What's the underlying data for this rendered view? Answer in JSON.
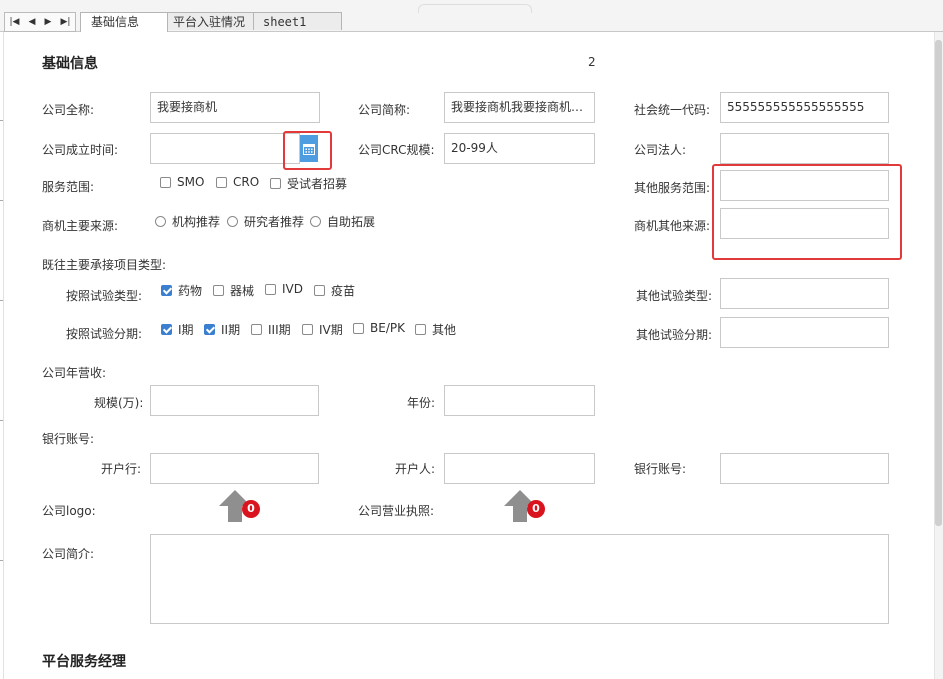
{
  "tabs": {
    "nav_first": "|◀",
    "nav_prev": "◀",
    "nav_next": "▶",
    "nav_last": "▶|",
    "items": [
      "基础信息",
      "平台入驻情况",
      "sheet1"
    ]
  },
  "basic": {
    "title": "基础信息",
    "page_number": "2",
    "company_name_label": "公司全称:",
    "company_name_value": "我要接商机",
    "short_name_label": "公司简称:",
    "short_name_value": "我要接商机我要接商机我要接商机",
    "credit_code_label": "社会统一代码:",
    "credit_code_value": "555555555555555555",
    "founded_label": "公司成立时间:",
    "founded_value": "",
    "crc_label": "公司CRC规模:",
    "crc_value": "20-99人",
    "legal_label": "公司法人:",
    "legal_value": "",
    "scope_label": "服务范围:",
    "scope_options": [
      {
        "label": "SMO",
        "checked": false
      },
      {
        "label": "CRO",
        "checked": false
      },
      {
        "label": "受试者招募",
        "checked": false
      }
    ],
    "other_scope_label": "其他服务范围:",
    "other_scope_value": "",
    "source_label": "商机主要来源:",
    "source_options": [
      "机构推荐",
      "研究者推荐",
      "自助拓展"
    ],
    "other_source_label": "商机其他来源:",
    "other_source_value": "",
    "project_type_label": "既往主要承接项目类型:",
    "trial_type_label": "按照试验类型:",
    "trial_type_options": [
      {
        "label": "药物",
        "checked": true
      },
      {
        "label": "器械",
        "checked": false
      },
      {
        "label": "IVD",
        "checked": false
      },
      {
        "label": "疫苗",
        "checked": false
      }
    ],
    "other_trial_type_label": "其他试验类型:",
    "other_trial_type_value": "",
    "trial_phase_label": "按照试验分期:",
    "trial_phase_options": [
      {
        "label": "I期",
        "checked": true
      },
      {
        "label": "II期",
        "checked": true
      },
      {
        "label": "III期",
        "checked": false
      },
      {
        "label": "IV期",
        "checked": false
      },
      {
        "label": "BE/PK",
        "checked": false
      },
      {
        "label": "其他",
        "checked": false
      }
    ],
    "other_trial_phase_label": "其他试验分期:",
    "other_trial_phase_value": "",
    "revenue_label": "公司年营收:",
    "scale_label": "规模(万):",
    "scale_value": "",
    "year_label": "年份:",
    "year_value": "",
    "bank_label": "银行账号:",
    "bank_name_label": "开户行:",
    "bank_name_value": "",
    "account_holder_label": "开户人:",
    "account_holder_value": "",
    "account_no_label": "银行账号:",
    "account_no_value": "",
    "logo_label": "公司logo:",
    "logo_count": "0",
    "license_label": "公司营业执照:",
    "license_count": "0",
    "intro_label": "公司简介:",
    "intro_value": ""
  },
  "manager": {
    "title": "平台服务经理"
  },
  "colors": {
    "accent": "#4d9de0",
    "checkbox": "#3a7fd0",
    "highlight": "#e23a3a",
    "badge": "#d9141e"
  }
}
